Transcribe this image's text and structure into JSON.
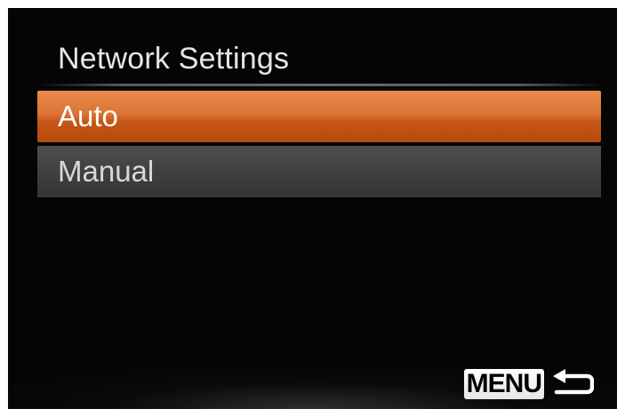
{
  "screen": {
    "title": "Network Settings"
  },
  "menu": {
    "items": [
      {
        "label": "Auto",
        "selected": true
      },
      {
        "label": "Manual",
        "selected": false
      }
    ]
  },
  "footer": {
    "menu_badge": "MENU",
    "back_icon": "return-arrow-icon"
  },
  "colors": {
    "selected_highlight": "#d9691f",
    "unselected_item": "#434343",
    "background": "#050505",
    "text": "#e6e6e6"
  }
}
